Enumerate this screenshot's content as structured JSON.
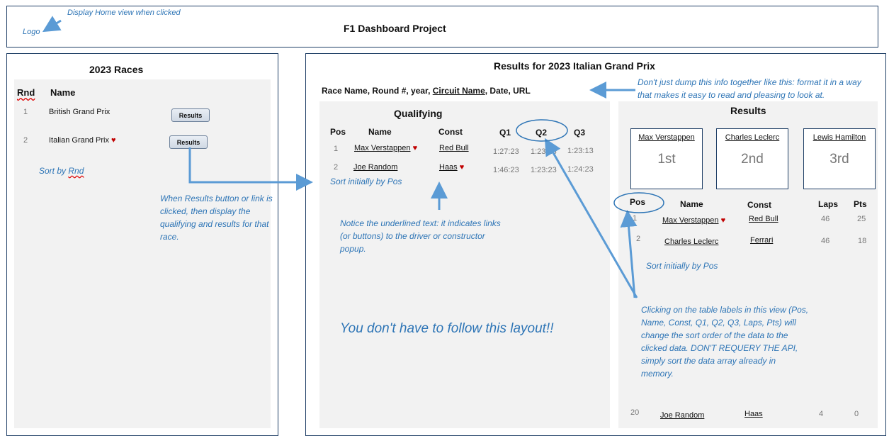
{
  "header": {
    "logo": "Logo",
    "logo_note": "Display Home view when clicked",
    "title": "F1 Dashboard Project"
  },
  "races_panel": {
    "title": "2023 Races",
    "col_rnd": "Rnd",
    "col_name": "Name",
    "rows": [
      {
        "rnd": "1",
        "name": "British Grand Prix",
        "button": "Results"
      },
      {
        "rnd": "2",
        "name": "Italian Grand Prix",
        "button": "Results"
      }
    ],
    "sort_note_prefix": "Sort by ",
    "sort_note_word": "Rnd",
    "results_note": "When Results button or link is clicked, then display the qualifying and results for that race."
  },
  "results_panel": {
    "title": "Results for 2023 Italian Grand Prix",
    "info_prefix": "Race Name, Round #, year, ",
    "info_circuit": "Circuit Name",
    "info_suffix": ", Date, URL",
    "format_note": "Don't just dump this info together like this: format it in a way that makes it easy to read and pleasing to look at.",
    "layout_note": "You don't have to follow this layout!!",
    "sort_note": "Clicking on the table labels in this view (Pos, Name, Const, Q1, Q2, Q3, Laps, Pts) will change the sort order of the data to the clicked data. DON'T REQUERY THE API, simply sort the data array already in memory."
  },
  "qualifying": {
    "title": "Qualifying",
    "headers": {
      "pos": "Pos",
      "name": "Name",
      "const": "Const",
      "q1": "Q1",
      "q2": "Q2",
      "q3": "Q3"
    },
    "rows": [
      {
        "pos": "1",
        "name": "Max Verstappen",
        "const": "Red Bull",
        "q1": "1:27:23",
        "q2": "1:23:23",
        "q3": "1:23:13"
      },
      {
        "pos": "2",
        "name": "Joe Random",
        "const": "Haas",
        "q1": "1:46:23",
        "q2": "1:23:23",
        "q3": "1:24:23"
      }
    ],
    "sort_note": "Sort initially by Pos",
    "underline_note": "Notice the underlined text: it indicates links (or buttons) to the driver or constructor popup."
  },
  "results": {
    "title": "Results",
    "podium": [
      {
        "name": "Max Verstappen",
        "place": "1st"
      },
      {
        "name": "Charles Leclerc",
        "place": "2nd"
      },
      {
        "name": "Lewis Hamilton",
        "place": "3rd"
      }
    ],
    "headers": {
      "pos": "Pos",
      "name": "Name",
      "const": "Const",
      "laps": "Laps",
      "pts": "Pts"
    },
    "rows": [
      {
        "pos": "1",
        "name": "Max Verstappen",
        "const": "Red Bull",
        "laps": "46",
        "pts": "25"
      },
      {
        "pos": "2",
        "name": "Charles Leclerc",
        "const": "Ferrari",
        "laps": "46",
        "pts": "18"
      },
      {
        "pos": "20",
        "name": "Joe Random",
        "const": "Haas",
        "laps": "4",
        "pts": "0"
      }
    ],
    "sort_note": "Sort initially by Pos"
  },
  "icons": {
    "heart": "heart-icon",
    "arrow": "arrow-annotation"
  },
  "colors": {
    "annotation": "#2e75b6",
    "border": "#1f3f66",
    "panel": "#f2f2f2",
    "heart": "#c00000"
  }
}
